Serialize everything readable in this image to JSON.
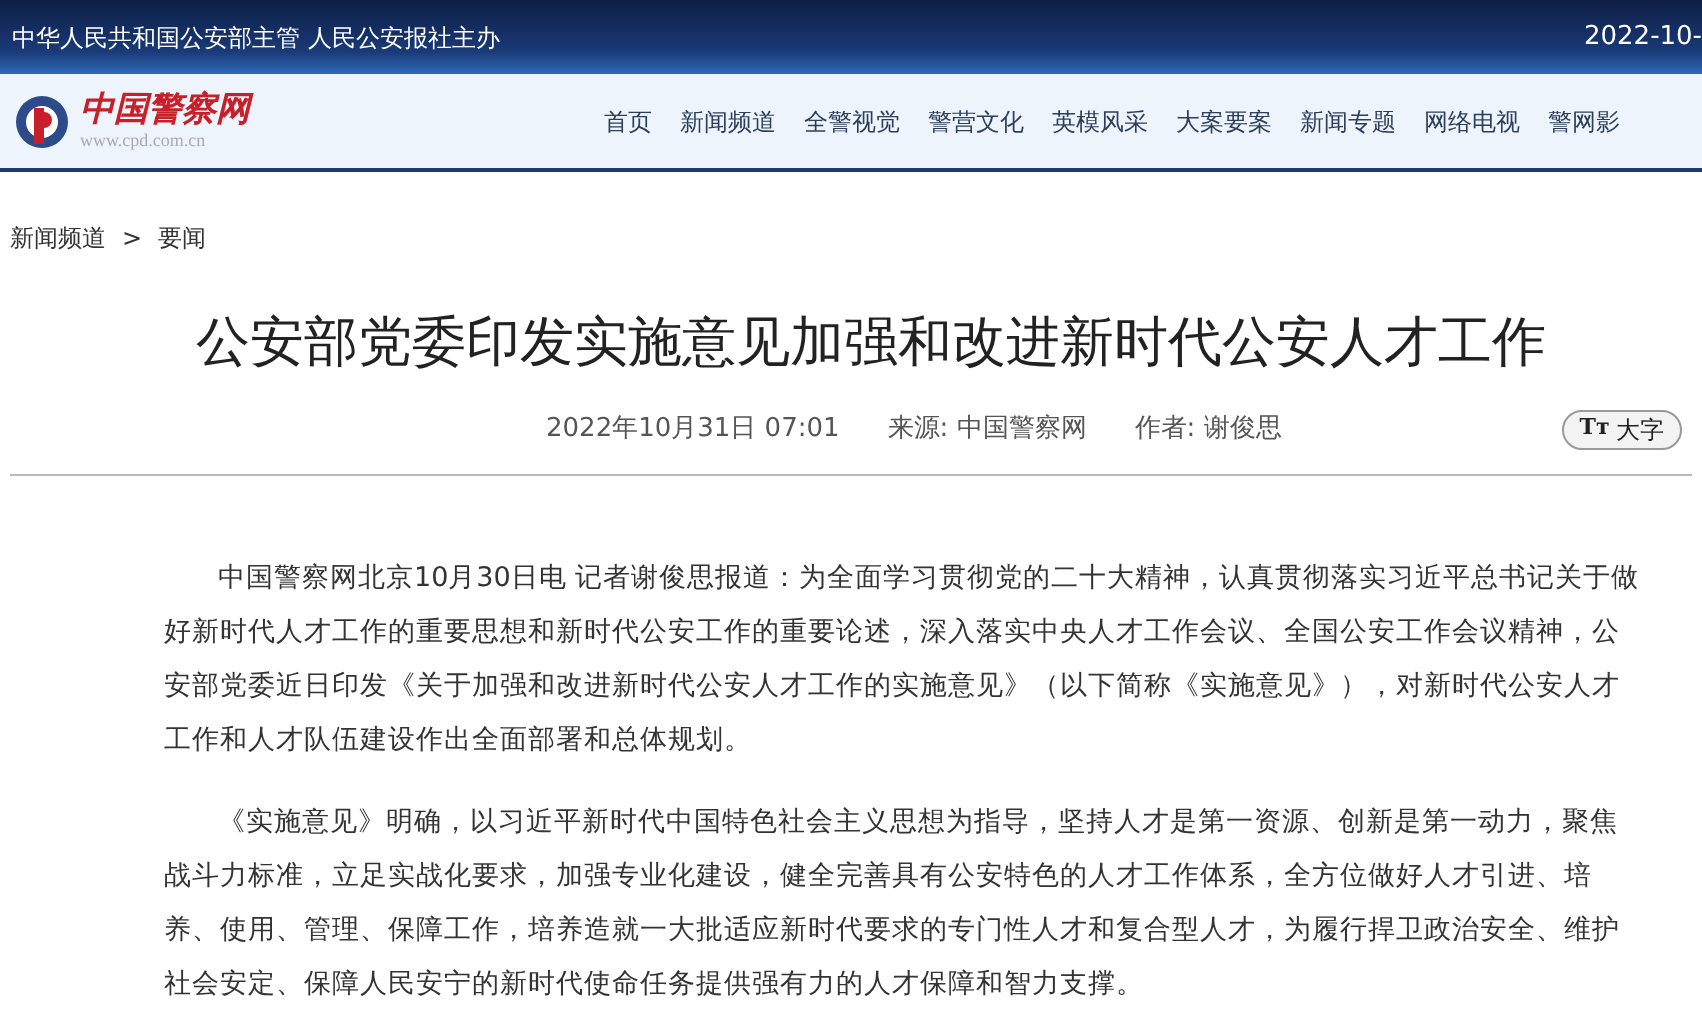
{
  "top_bar": {
    "slogan": "中华人民共和国公安部主管 人民公安报社主办",
    "date": "2022-10-"
  },
  "logo": {
    "name": "中国警察网",
    "url": "www.cpd.com.cn"
  },
  "nav": [
    "首页",
    "新闻频道",
    "全警视觉",
    "警营文化",
    "英模风采",
    "大案要案",
    "新闻专题",
    "网络电视",
    "警网影"
  ],
  "breadcrumb": [
    "新闻频道",
    "要闻"
  ],
  "breadcrumb_separator": ">",
  "article": {
    "title": "公安部党委印发实施意见加强和改进新时代公安人才工作",
    "datetime": "2022年10月31日 07:01",
    "source": "来源: 中国警察网",
    "author": "作者: 谢俊思",
    "font_button": {
      "icon": "Tт",
      "label": "大字"
    },
    "paragraphs": [
      "中国警察网北京10月30日电 记者谢俊思报道：为全面学习贯彻党的二十大精神，认真贯彻落实习近平总书记关于做好新时代人才工作的重要思想和新时代公安工作的重要论述，深入落实中央人才工作会议、全国公安工作会议精神，公安部党委近日印发《关于加强和改进新时代公安人才工作的实施意见》（以下简称《实施意见》），对新时代公安人才工作和人才队伍建设作出全面部署和总体规划。",
      "《实施意见》明确，以习近平新时代中国特色社会主义思想为指导，坚持人才是第一资源、创新是第一动力，聚焦战斗力标准，立足实战化要求，加强专业化建设，健全完善具有公安特色的人才工作体系，全方位做好人才引进、培养、使用、管理、保障工作，培养造就一大批适应新时代要求的专门性人才和复合型人才，为履行捍卫政治安全、维护社会安定、保障人民安宁的新时代使命任务提供强有力的人才保障和智力支撑。"
    ]
  }
}
